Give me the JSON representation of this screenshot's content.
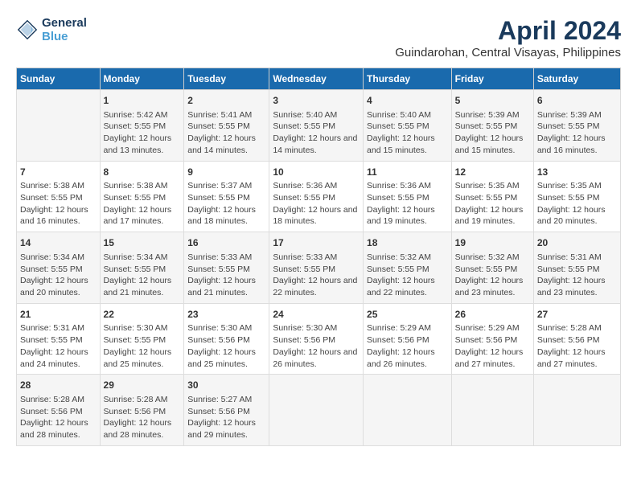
{
  "logo": {
    "line1": "General",
    "line2": "Blue"
  },
  "title": "April 2024",
  "subtitle": "Guindarohan, Central Visayas, Philippines",
  "days_of_week": [
    "Sunday",
    "Monday",
    "Tuesday",
    "Wednesday",
    "Thursday",
    "Friday",
    "Saturday"
  ],
  "weeks": [
    [
      {
        "day": "",
        "sunrise": "",
        "sunset": "",
        "daylight": ""
      },
      {
        "day": "1",
        "sunrise": "Sunrise: 5:42 AM",
        "sunset": "Sunset: 5:55 PM",
        "daylight": "Daylight: 12 hours and 13 minutes."
      },
      {
        "day": "2",
        "sunrise": "Sunrise: 5:41 AM",
        "sunset": "Sunset: 5:55 PM",
        "daylight": "Daylight: 12 hours and 14 minutes."
      },
      {
        "day": "3",
        "sunrise": "Sunrise: 5:40 AM",
        "sunset": "Sunset: 5:55 PM",
        "daylight": "Daylight: 12 hours and 14 minutes."
      },
      {
        "day": "4",
        "sunrise": "Sunrise: 5:40 AM",
        "sunset": "Sunset: 5:55 PM",
        "daylight": "Daylight: 12 hours and 15 minutes."
      },
      {
        "day": "5",
        "sunrise": "Sunrise: 5:39 AM",
        "sunset": "Sunset: 5:55 PM",
        "daylight": "Daylight: 12 hours and 15 minutes."
      },
      {
        "day": "6",
        "sunrise": "Sunrise: 5:39 AM",
        "sunset": "Sunset: 5:55 PM",
        "daylight": "Daylight: 12 hours and 16 minutes."
      }
    ],
    [
      {
        "day": "7",
        "sunrise": "Sunrise: 5:38 AM",
        "sunset": "Sunset: 5:55 PM",
        "daylight": "Daylight: 12 hours and 16 minutes."
      },
      {
        "day": "8",
        "sunrise": "Sunrise: 5:38 AM",
        "sunset": "Sunset: 5:55 PM",
        "daylight": "Daylight: 12 hours and 17 minutes."
      },
      {
        "day": "9",
        "sunrise": "Sunrise: 5:37 AM",
        "sunset": "Sunset: 5:55 PM",
        "daylight": "Daylight: 12 hours and 18 minutes."
      },
      {
        "day": "10",
        "sunrise": "Sunrise: 5:36 AM",
        "sunset": "Sunset: 5:55 PM",
        "daylight": "Daylight: 12 hours and 18 minutes."
      },
      {
        "day": "11",
        "sunrise": "Sunrise: 5:36 AM",
        "sunset": "Sunset: 5:55 PM",
        "daylight": "Daylight: 12 hours and 19 minutes."
      },
      {
        "day": "12",
        "sunrise": "Sunrise: 5:35 AM",
        "sunset": "Sunset: 5:55 PM",
        "daylight": "Daylight: 12 hours and 19 minutes."
      },
      {
        "day": "13",
        "sunrise": "Sunrise: 5:35 AM",
        "sunset": "Sunset: 5:55 PM",
        "daylight": "Daylight: 12 hours and 20 minutes."
      }
    ],
    [
      {
        "day": "14",
        "sunrise": "Sunrise: 5:34 AM",
        "sunset": "Sunset: 5:55 PM",
        "daylight": "Daylight: 12 hours and 20 minutes."
      },
      {
        "day": "15",
        "sunrise": "Sunrise: 5:34 AM",
        "sunset": "Sunset: 5:55 PM",
        "daylight": "Daylight: 12 hours and 21 minutes."
      },
      {
        "day": "16",
        "sunrise": "Sunrise: 5:33 AM",
        "sunset": "Sunset: 5:55 PM",
        "daylight": "Daylight: 12 hours and 21 minutes."
      },
      {
        "day": "17",
        "sunrise": "Sunrise: 5:33 AM",
        "sunset": "Sunset: 5:55 PM",
        "daylight": "Daylight: 12 hours and 22 minutes."
      },
      {
        "day": "18",
        "sunrise": "Sunrise: 5:32 AM",
        "sunset": "Sunset: 5:55 PM",
        "daylight": "Daylight: 12 hours and 22 minutes."
      },
      {
        "day": "19",
        "sunrise": "Sunrise: 5:32 AM",
        "sunset": "Sunset: 5:55 PM",
        "daylight": "Daylight: 12 hours and 23 minutes."
      },
      {
        "day": "20",
        "sunrise": "Sunrise: 5:31 AM",
        "sunset": "Sunset: 5:55 PM",
        "daylight": "Daylight: 12 hours and 23 minutes."
      }
    ],
    [
      {
        "day": "21",
        "sunrise": "Sunrise: 5:31 AM",
        "sunset": "Sunset: 5:55 PM",
        "daylight": "Daylight: 12 hours and 24 minutes."
      },
      {
        "day": "22",
        "sunrise": "Sunrise: 5:30 AM",
        "sunset": "Sunset: 5:55 PM",
        "daylight": "Daylight: 12 hours and 25 minutes."
      },
      {
        "day": "23",
        "sunrise": "Sunrise: 5:30 AM",
        "sunset": "Sunset: 5:56 PM",
        "daylight": "Daylight: 12 hours and 25 minutes."
      },
      {
        "day": "24",
        "sunrise": "Sunrise: 5:30 AM",
        "sunset": "Sunset: 5:56 PM",
        "daylight": "Daylight: 12 hours and 26 minutes."
      },
      {
        "day": "25",
        "sunrise": "Sunrise: 5:29 AM",
        "sunset": "Sunset: 5:56 PM",
        "daylight": "Daylight: 12 hours and 26 minutes."
      },
      {
        "day": "26",
        "sunrise": "Sunrise: 5:29 AM",
        "sunset": "Sunset: 5:56 PM",
        "daylight": "Daylight: 12 hours and 27 minutes."
      },
      {
        "day": "27",
        "sunrise": "Sunrise: 5:28 AM",
        "sunset": "Sunset: 5:56 PM",
        "daylight": "Daylight: 12 hours and 27 minutes."
      }
    ],
    [
      {
        "day": "28",
        "sunrise": "Sunrise: 5:28 AM",
        "sunset": "Sunset: 5:56 PM",
        "daylight": "Daylight: 12 hours and 28 minutes."
      },
      {
        "day": "29",
        "sunrise": "Sunrise: 5:28 AM",
        "sunset": "Sunset: 5:56 PM",
        "daylight": "Daylight: 12 hours and 28 minutes."
      },
      {
        "day": "30",
        "sunrise": "Sunrise: 5:27 AM",
        "sunset": "Sunset: 5:56 PM",
        "daylight": "Daylight: 12 hours and 29 minutes."
      },
      {
        "day": "",
        "sunrise": "",
        "sunset": "",
        "daylight": ""
      },
      {
        "day": "",
        "sunrise": "",
        "sunset": "",
        "daylight": ""
      },
      {
        "day": "",
        "sunrise": "",
        "sunset": "",
        "daylight": ""
      },
      {
        "day": "",
        "sunrise": "",
        "sunset": "",
        "daylight": ""
      }
    ]
  ]
}
